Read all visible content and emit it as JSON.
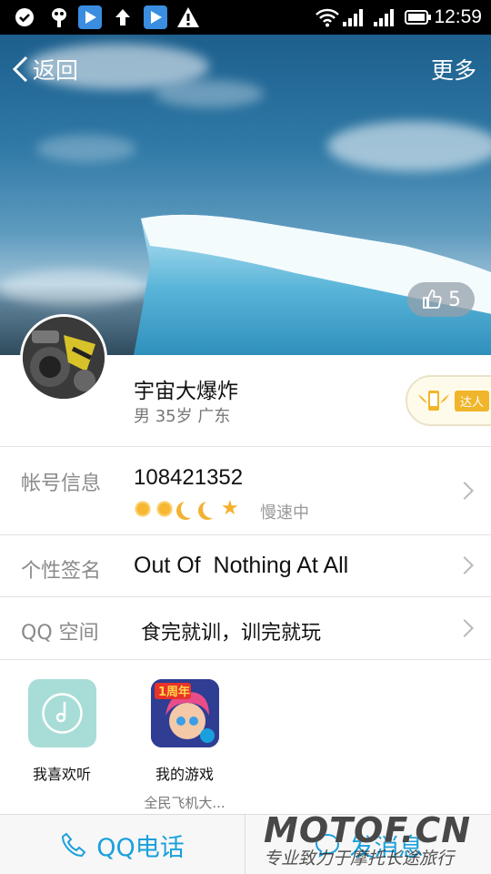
{
  "status_bar": {
    "time": "12:59",
    "left_icons": [
      "check-icon",
      "notification-icon",
      "play-store-icon",
      "upload-icon",
      "play-store-icon",
      "warning-icon"
    ],
    "right_icons": [
      "wifi-icon",
      "signal-icon",
      "signal-icon",
      "battery-icon"
    ]
  },
  "nav": {
    "back_label": "返回",
    "more_label": "更多"
  },
  "cover": {
    "likes": "5"
  },
  "profile": {
    "nickname": "宇宙大爆炸",
    "info": "男 35岁 广东",
    "badge_label": "达人"
  },
  "account": {
    "label": "帐号信息",
    "qq_number": "108421352",
    "level_icons": [
      "sun-icon",
      "sun-icon",
      "moon-icon",
      "moon-icon",
      "star-icon"
    ],
    "speed_label": "慢速中"
  },
  "signature": {
    "label": "个性签名",
    "value": "Out Of  Nothing At All"
  },
  "qzone": {
    "label": "QQ 空间",
    "value": "食完就训，训完就玩"
  },
  "apps": [
    {
      "name": "我喜欢听",
      "sub": ""
    },
    {
      "name": "我的游戏",
      "sub": "全民飞机大..."
    }
  ],
  "bottom_bar": {
    "call_label": "QQ电话",
    "message_label": "发消息"
  },
  "watermark": {
    "main": "MOTOF.CN",
    "sub": "专业致力于摩托长途旅行"
  },
  "colors": {
    "accent": "#1aa0dc",
    "badge": "#f0b52a"
  }
}
